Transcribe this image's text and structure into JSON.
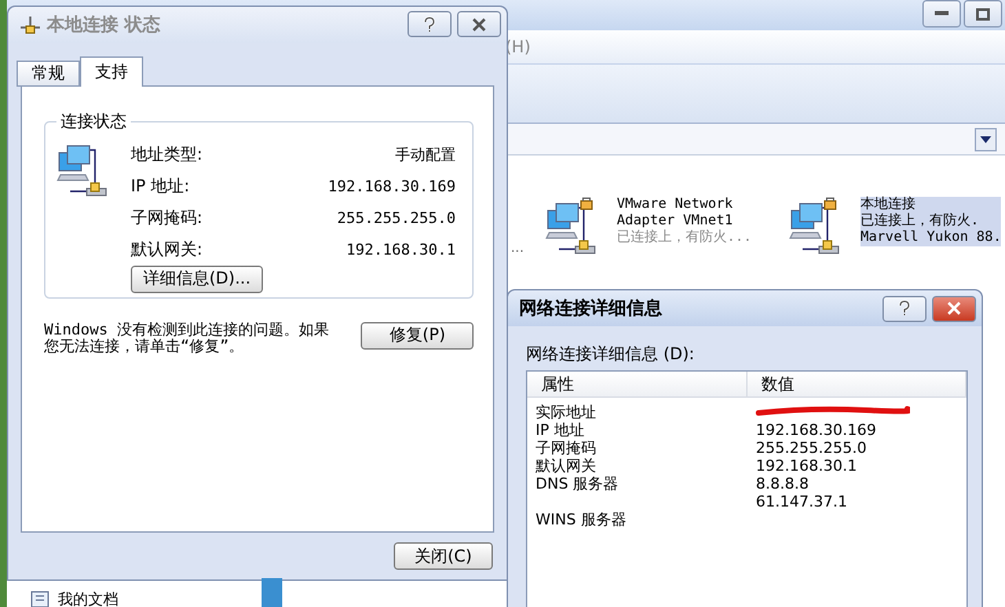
{
  "explorer": {
    "menu_fragment": "(H)",
    "cut_status": "...",
    "connections": [
      {
        "kind": "adapter",
        "name": "VMware Network Adapter VMnet1",
        "status": "已连接上，有防火...",
        "selected": false
      },
      {
        "kind": "adapter",
        "name": "本地连接",
        "status": "已连接上，有防火.",
        "device": "Marvell Yukon 88.",
        "selected": true
      }
    ],
    "side_item": "我的文档"
  },
  "status_dialog": {
    "title": "本地连接 状态",
    "active": false,
    "tabs": [
      {
        "label": "常规",
        "selected": false
      },
      {
        "label": "支持",
        "selected": true
      }
    ],
    "group_title": "连接状态",
    "rows": [
      {
        "label": "地址类型:",
        "value": "手动配置"
      },
      {
        "label": "IP 地址:",
        "value": "192.168.30.169"
      },
      {
        "label": "子网掩码:",
        "value": "255.255.255.0"
      },
      {
        "label": "默认网关:",
        "value": "192.168.30.1"
      }
    ],
    "details_button": "详细信息(D)...",
    "message": "Windows 没有检测到此连接的问题。如果您无法连接，请单击“修复”。",
    "repair_button": "修复(P)",
    "close_button": "关闭(C)"
  },
  "details_dialog": {
    "title": "网络连接详细信息",
    "active": true,
    "list_label": "网络连接详细信息 (D):",
    "columns": [
      "属性",
      "数值"
    ],
    "rows": [
      {
        "property": "实际地址",
        "redacted": true
      },
      {
        "property": "IP 地址",
        "value": "192.168.30.169"
      },
      {
        "property": "子网掩码",
        "value": "255.255.255.0"
      },
      {
        "property": "默认网关",
        "value": "192.168.30.1"
      },
      {
        "property": "DNS 服务器",
        "value": "8.8.8.8"
      },
      {
        "value": "61.147.37.1"
      },
      {
        "property": "WINS 服务器"
      }
    ]
  }
}
